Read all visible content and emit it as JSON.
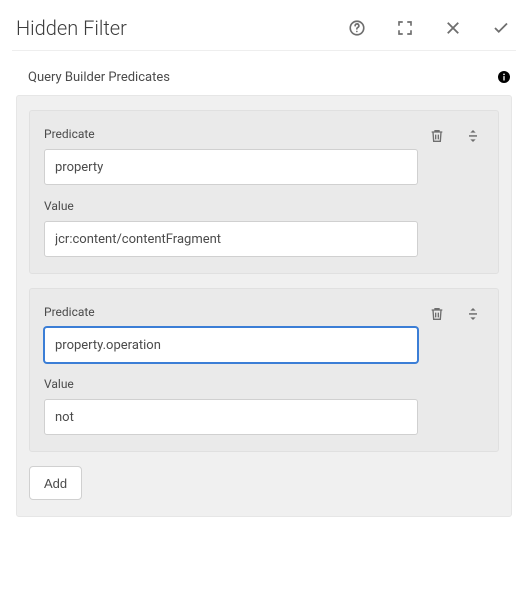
{
  "header": {
    "title": "Hidden Filter"
  },
  "section": {
    "title": "Query Builder Predicates"
  },
  "predicates": [
    {
      "predicate_label": "Predicate",
      "predicate_value": "property",
      "value_label": "Value",
      "value_value": "jcr:content/contentFragment",
      "focused_field": ""
    },
    {
      "predicate_label": "Predicate",
      "predicate_value": "property.operation",
      "value_label": "Value",
      "value_value": "not",
      "focused_field": "predicate"
    }
  ],
  "buttons": {
    "add": "Add"
  }
}
